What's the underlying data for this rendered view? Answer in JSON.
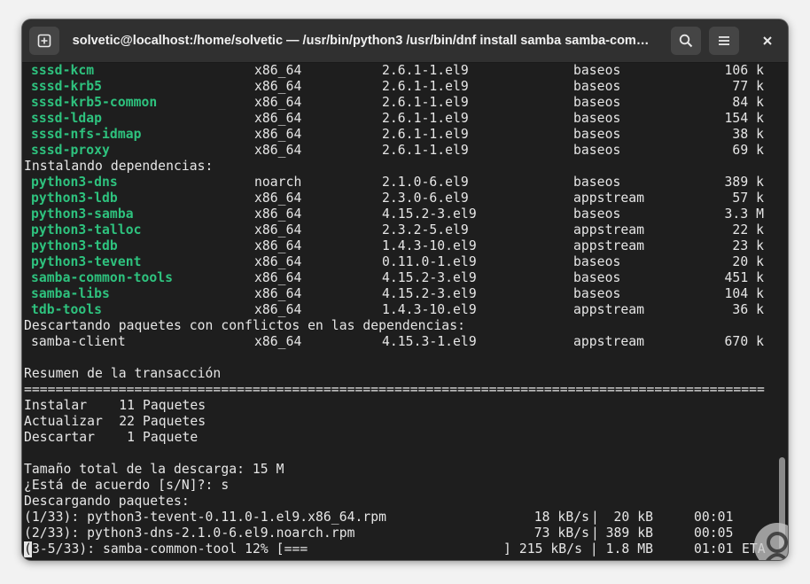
{
  "window": {
    "title": "solvetic@localhost:/home/solvetic — /usr/bin/python3 /usr/bin/dnf install samba samba-com…"
  },
  "icons": {
    "new_tab": "new-tab-icon",
    "search": "search-icon",
    "menu": "hamburger-menu-icon",
    "close": "close-icon"
  },
  "colors": {
    "package_green": "#2ec27e",
    "terminal_bg": "#1e1e1e",
    "titlebar_bg": "#303030"
  },
  "packages_top": [
    {
      "name": "sssd-kcm",
      "arch": "x86_64",
      "version": "2.6.1-1.el9",
      "repo": "baseos",
      "size": "106 k"
    },
    {
      "name": "sssd-krb5",
      "arch": "x86_64",
      "version": "2.6.1-1.el9",
      "repo": "baseos",
      "size": "77 k"
    },
    {
      "name": "sssd-krb5-common",
      "arch": "x86_64",
      "version": "2.6.1-1.el9",
      "repo": "baseos",
      "size": "84 k"
    },
    {
      "name": "sssd-ldap",
      "arch": "x86_64",
      "version": "2.6.1-1.el9",
      "repo": "baseos",
      "size": "154 k"
    },
    {
      "name": "sssd-nfs-idmap",
      "arch": "x86_64",
      "version": "2.6.1-1.el9",
      "repo": "baseos",
      "size": "38 k"
    },
    {
      "name": "sssd-proxy",
      "arch": "x86_64",
      "version": "2.6.1-1.el9",
      "repo": "baseos",
      "size": "69 k"
    }
  ],
  "heading_deps": "Instalando dependencias:",
  "packages_deps": [
    {
      "name": "python3-dns",
      "arch": "noarch",
      "version": "2.1.0-6.el9",
      "repo": "baseos",
      "size": "389 k"
    },
    {
      "name": "python3-ldb",
      "arch": "x86_64",
      "version": "2.3.0-6.el9",
      "repo": "appstream",
      "size": "57 k"
    },
    {
      "name": "python3-samba",
      "arch": "x86_64",
      "version": "4.15.2-3.el9",
      "repo": "baseos",
      "size": "3.3 M"
    },
    {
      "name": "python3-talloc",
      "arch": "x86_64",
      "version": "2.3.2-5.el9",
      "repo": "appstream",
      "size": "22 k"
    },
    {
      "name": "python3-tdb",
      "arch": "x86_64",
      "version": "1.4.3-10.el9",
      "repo": "appstream",
      "size": "23 k"
    },
    {
      "name": "python3-tevent",
      "arch": "x86_64",
      "version": "0.11.0-1.el9",
      "repo": "baseos",
      "size": "20 k"
    },
    {
      "name": "samba-common-tools",
      "arch": "x86_64",
      "version": "4.15.2-3.el9",
      "repo": "baseos",
      "size": "451 k"
    },
    {
      "name": "samba-libs",
      "arch": "x86_64",
      "version": "4.15.2-3.el9",
      "repo": "baseos",
      "size": "104 k"
    },
    {
      "name": "tdb-tools",
      "arch": "x86_64",
      "version": "1.4.3-10.el9",
      "repo": "appstream",
      "size": "36 k"
    }
  ],
  "heading_conflicts": "Descartando paquetes con conflictos en las dependencias:",
  "packages_conflicts": [
    {
      "name": "samba-client",
      "arch": "x86_64",
      "version": "4.15.3-1.el9",
      "repo": "appstream",
      "size": "670 k"
    }
  ],
  "summary_heading": "Resumen de la transacción",
  "separator": "==============================================================================================",
  "summary": [
    {
      "label": "Instalar",
      "count": "11",
      "unit": "Paquetes"
    },
    {
      "label": "Actualizar",
      "count": "22",
      "unit": "Paquetes"
    },
    {
      "label": "Descartar",
      "count": "1",
      "unit": "Paquete"
    }
  ],
  "download_size": "Tamaño total de la descarga: 15 M",
  "confirm": "¿Está de acuerdo [s/N]?: s",
  "downloading": "Descargando paquetes:",
  "downloads": [
    {
      "file": "(1/33): python3-tevent-0.11.0-1.el9.x86_64.rpm",
      "speed": "18 kB/s",
      "size": "20 kB",
      "time": "00:01"
    },
    {
      "file": "(2/33): python3-dns-2.1.0-6.el9.noarch.rpm",
      "speed": "73 kB/s",
      "size": "389 kB",
      "time": "00:05"
    }
  ],
  "progress": {
    "cursor_char": "(",
    "rest": "3-5/33): samba-common-tool 12% [===",
    "fraction": 0.12,
    "tail": "] 215 kB/s | 1.8 MB",
    "eta_time": "01:01",
    "eta_label": "ETA"
  }
}
